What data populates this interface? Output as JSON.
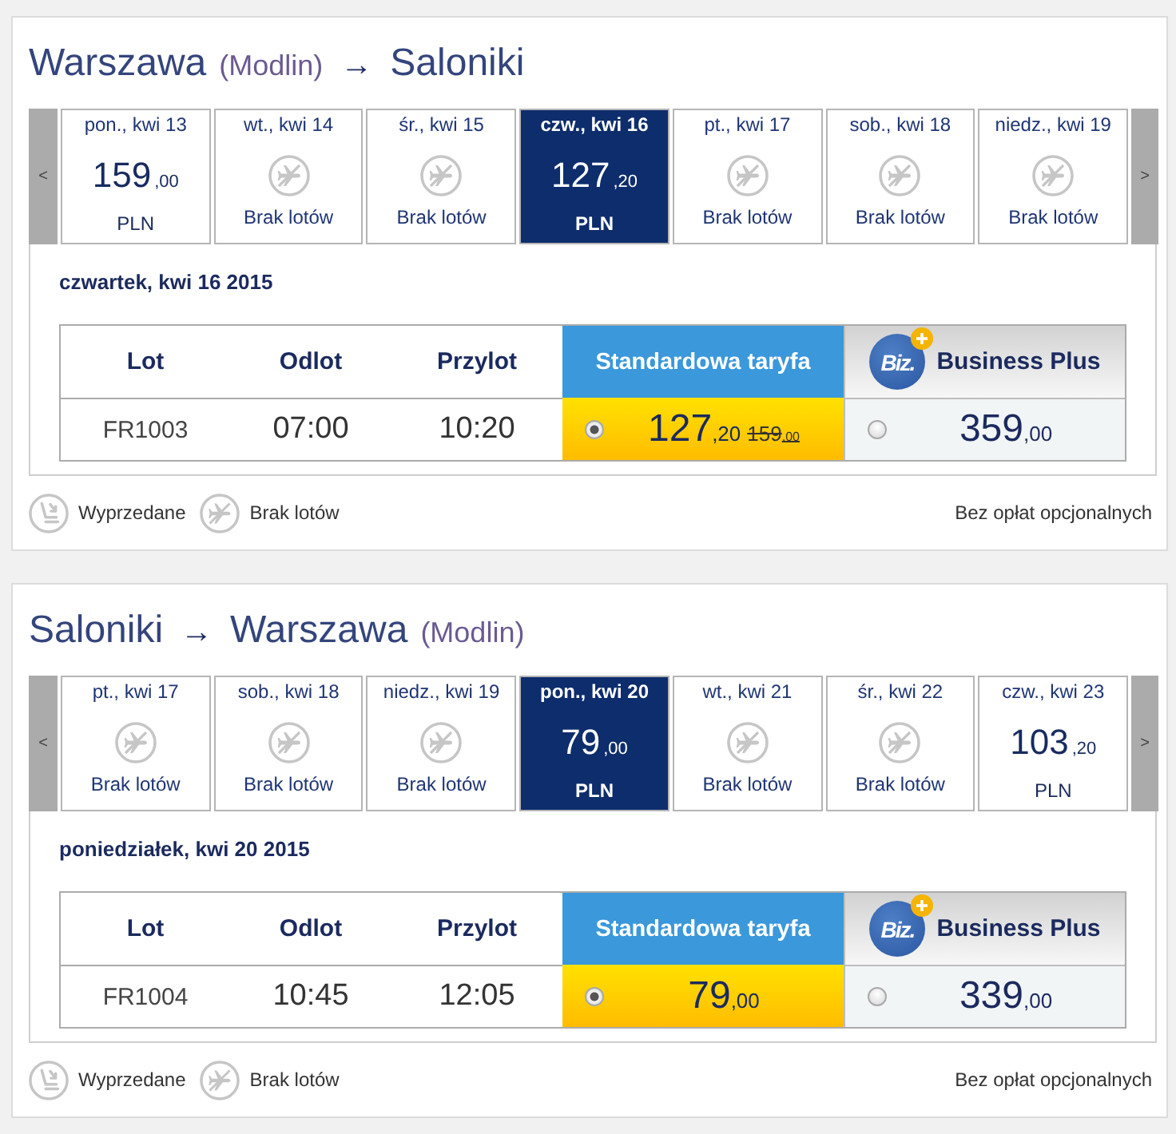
{
  "journeys": [
    {
      "title": [
        {
          "kind": "city",
          "text": "Warszawa"
        },
        {
          "kind": "airport",
          "text": "(Modlin)"
        },
        {
          "kind": "arrow",
          "text": "→"
        },
        {
          "kind": "city",
          "text": "Saloniki"
        }
      ],
      "date_strip": {
        "prev": "<",
        "next": ">",
        "days": [
          {
            "label": "pon., kwi 13",
            "kind": "fare",
            "price": "159",
            "decimals": ",00",
            "currency": "PLN",
            "selected": false
          },
          {
            "label": "wt., kwi 14",
            "kind": "no_flights",
            "status": "Brak lotów",
            "selected": false
          },
          {
            "label": "śr., kwi 15",
            "kind": "no_flights",
            "status": "Brak lotów",
            "selected": false
          },
          {
            "label": "czw., kwi 16",
            "kind": "fare",
            "price": "127",
            "decimals": ",20",
            "currency": "PLN",
            "selected": true
          },
          {
            "label": "pt., kwi 17",
            "kind": "no_flights",
            "status": "Brak lotów",
            "selected": false
          },
          {
            "label": "sob., kwi 18",
            "kind": "no_flights",
            "status": "Brak lotów",
            "selected": false
          },
          {
            "label": "niedz., kwi 19",
            "kind": "no_flights",
            "status": "Brak lotów",
            "selected": false
          }
        ]
      },
      "selected_date": "czwartek, kwi 16 2015",
      "table": {
        "columns": [
          {
            "kind": "text",
            "label": "Lot"
          },
          {
            "kind": "text",
            "label": "Odlot"
          },
          {
            "kind": "text",
            "label": "Przylot"
          },
          {
            "kind": "standard",
            "label": "Standardowa taryfa"
          },
          {
            "kind": "business",
            "label": "Business Plus",
            "logo": "Biz."
          }
        ],
        "flights": [
          {
            "cells": [
              {
                "kind": "flight",
                "text": "FR1003"
              },
              {
                "kind": "time",
                "text": "07:00"
              },
              {
                "kind": "time",
                "text": "10:20"
              }
            ],
            "fares": [
              {
                "selected": true,
                "price": "127",
                "decimals": ",20",
                "old_price": "159",
                "old_decimals": ",00"
              },
              {
                "selected": false,
                "price": "359",
                "decimals": ",00"
              }
            ]
          }
        ]
      },
      "legend": [
        {
          "kind": "sold_out",
          "label": "Wyprzedane"
        },
        {
          "kind": "no_flights",
          "label": "Brak lotów"
        }
      ],
      "fee_note": "Bez opłat opcjonalnych"
    },
    {
      "title": [
        {
          "kind": "city",
          "text": "Saloniki"
        },
        {
          "kind": "arrow",
          "text": "→"
        },
        {
          "kind": "city",
          "text": "Warszawa"
        },
        {
          "kind": "airport",
          "text": "(Modlin)"
        }
      ],
      "date_strip": {
        "prev": "<",
        "next": ">",
        "days": [
          {
            "label": "pt., kwi 17",
            "kind": "no_flights",
            "status": "Brak lotów",
            "selected": false
          },
          {
            "label": "sob., kwi 18",
            "kind": "no_flights",
            "status": "Brak lotów",
            "selected": false
          },
          {
            "label": "niedz., kwi 19",
            "kind": "no_flights",
            "status": "Brak lotów",
            "selected": false
          },
          {
            "label": "pon., kwi 20",
            "kind": "fare",
            "price": "79",
            "decimals": ",00",
            "currency": "PLN",
            "selected": true
          },
          {
            "label": "wt., kwi 21",
            "kind": "no_flights",
            "status": "Brak lotów",
            "selected": false
          },
          {
            "label": "śr., kwi 22",
            "kind": "no_flights",
            "status": "Brak lotów",
            "selected": false
          },
          {
            "label": "czw., kwi 23",
            "kind": "fare",
            "price": "103",
            "decimals": ",20",
            "currency": "PLN",
            "selected": false
          }
        ]
      },
      "selected_date": "poniedziałek, kwi 20 2015",
      "table": {
        "columns": [
          {
            "kind": "text",
            "label": "Lot"
          },
          {
            "kind": "text",
            "label": "Odlot"
          },
          {
            "kind": "text",
            "label": "Przylot"
          },
          {
            "kind": "standard",
            "label": "Standardowa taryfa"
          },
          {
            "kind": "business",
            "label": "Business Plus",
            "logo": "Biz."
          }
        ],
        "flights": [
          {
            "cells": [
              {
                "kind": "flight",
                "text": "FR1004"
              },
              {
                "kind": "time",
                "text": "10:45"
              },
              {
                "kind": "time",
                "text": "12:05"
              }
            ],
            "fares": [
              {
                "selected": true,
                "price": "79",
                "decimals": ",00"
              },
              {
                "selected": false,
                "price": "339",
                "decimals": ",00"
              }
            ]
          }
        ]
      },
      "legend": [
        {
          "kind": "sold_out",
          "label": "Wyprzedane"
        },
        {
          "kind": "no_flights",
          "label": "Brak lotów"
        }
      ],
      "fee_note": "Bez opłat opcjonalnych"
    }
  ]
}
